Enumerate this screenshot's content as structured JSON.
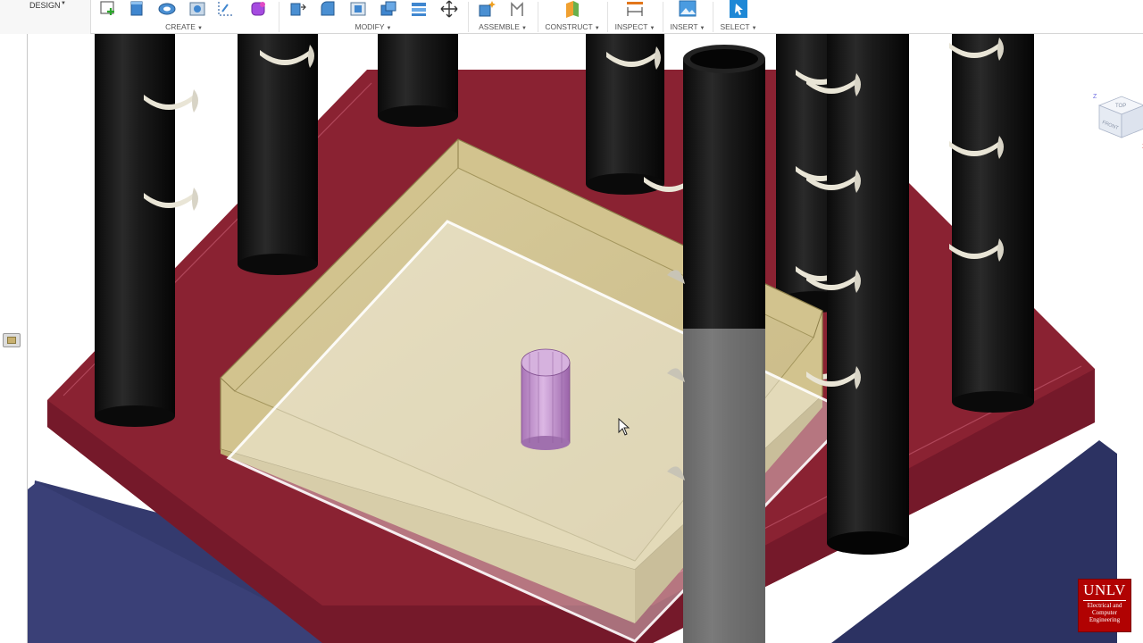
{
  "toolbar": {
    "workspace": "DESIGN",
    "groups": [
      {
        "id": "create",
        "label": "CREATE"
      },
      {
        "id": "modify",
        "label": "MODIFY"
      },
      {
        "id": "assemble",
        "label": "ASSEMBLE"
      },
      {
        "id": "construct",
        "label": "CONSTRUCT"
      },
      {
        "id": "inspect",
        "label": "INSPECT"
      },
      {
        "id": "insert",
        "label": "INSERT"
      },
      {
        "id": "select",
        "label": "SELECT"
      }
    ]
  },
  "viewcube": {
    "faces": {
      "top": "TOP",
      "front": "FRONT"
    },
    "axes": {
      "z": "Z",
      "x": "X"
    }
  },
  "badge": {
    "title": "UNLV",
    "line1": "Electrical and",
    "line2": "Computer",
    "line3": "Engineering"
  },
  "colors": {
    "base_plate": "#8a2232",
    "base_block": "#343a6e",
    "tray": "#d2c38e",
    "pillars": "#151515",
    "pin": "#c79ad0",
    "accent": "#1e88d6"
  }
}
